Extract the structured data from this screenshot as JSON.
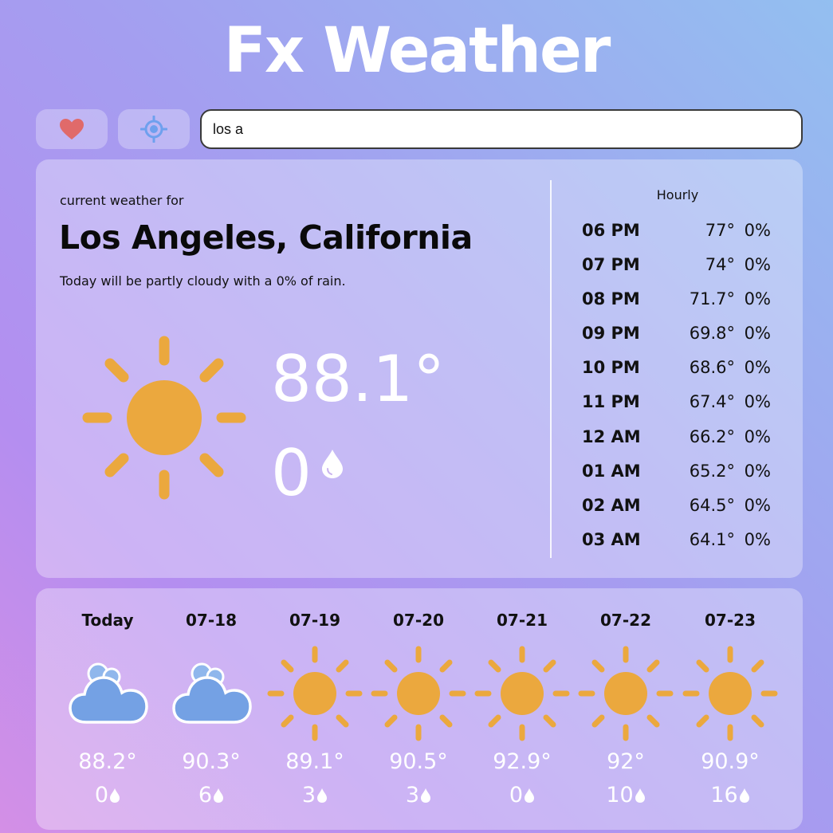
{
  "app": {
    "title": "Fx Weather"
  },
  "toolbar": {
    "favorite_icon": "heart-icon",
    "location_icon": "crosshair-icon",
    "search_value": "los a"
  },
  "current": {
    "label": "current weather for",
    "city": "Los Angeles, California",
    "summary": "Today will be partly cloudy with a 0% of rain.",
    "condition_icon": "sun-icon",
    "temperature": "88.1°",
    "precipitation": "0"
  },
  "hourly": {
    "title": "Hourly",
    "rows": [
      {
        "time": "06 PM",
        "temp": "77°",
        "precip": "0%"
      },
      {
        "time": "07 PM",
        "temp": "74°",
        "precip": "0%"
      },
      {
        "time": "08 PM",
        "temp": "71.7°",
        "precip": "0%"
      },
      {
        "time": "09 PM",
        "temp": "69.8°",
        "precip": "0%"
      },
      {
        "time": "10 PM",
        "temp": "68.6°",
        "precip": "0%"
      },
      {
        "time": "11 PM",
        "temp": "67.4°",
        "precip": "0%"
      },
      {
        "time": "12 AM",
        "temp": "66.2°",
        "precip": "0%"
      },
      {
        "time": "01 AM",
        "temp": "65.2°",
        "precip": "0%"
      },
      {
        "time": "02 AM",
        "temp": "64.5°",
        "precip": "0%"
      },
      {
        "time": "03 AM",
        "temp": "64.1°",
        "precip": "0%"
      }
    ]
  },
  "forecast": [
    {
      "day": "Today",
      "icon": "cloudy-icon",
      "temp": "88.2°",
      "precip": "0"
    },
    {
      "day": "07-18",
      "icon": "cloudy-icon",
      "temp": "90.3°",
      "precip": "6"
    },
    {
      "day": "07-19",
      "icon": "sun-icon",
      "temp": "89.1°",
      "precip": "3"
    },
    {
      "day": "07-20",
      "icon": "sun-icon",
      "temp": "90.5°",
      "precip": "3"
    },
    {
      "day": "07-21",
      "icon": "sun-icon",
      "temp": "92.9°",
      "precip": "0"
    },
    {
      "day": "07-22",
      "icon": "sun-icon",
      "temp": "92°",
      "precip": "10"
    },
    {
      "day": "07-23",
      "icon": "sun-icon",
      "temp": "90.9°",
      "precip": "16"
    }
  ],
  "colors": {
    "sun": "#eba83e",
    "cloud": "#74a1e4",
    "heart": "#e06a6a",
    "crosshair": "#6ea0ee"
  }
}
